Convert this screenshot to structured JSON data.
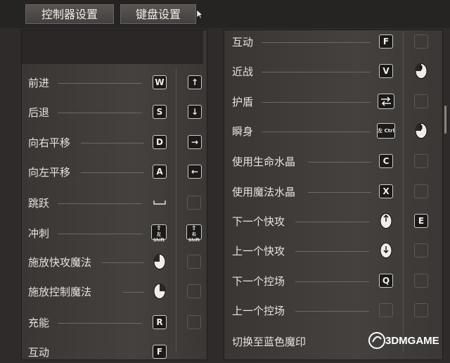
{
  "tabs": [
    {
      "label": "控制器设置"
    },
    {
      "label": "键盘设置"
    }
  ],
  "left_rows": [
    {
      "label": "前进",
      "primary": "W",
      "secondary": "↑"
    },
    {
      "label": "后退",
      "primary": "S",
      "secondary": "↓"
    },
    {
      "label": "向右平移",
      "primary": "D",
      "secondary": "→"
    },
    {
      "label": "向左平移",
      "primary": "A",
      "secondary": "←"
    },
    {
      "label": "跳跃",
      "primary": "space-key",
      "secondary": ""
    },
    {
      "label": "冲刺",
      "primary": "左 Shift",
      "secondary": "右 Shift"
    },
    {
      "label": "施放快攻魔法",
      "primary": "left-mouse-icon",
      "secondary": ""
    },
    {
      "label": "施放控制魔法",
      "primary": "right-mouse-icon",
      "secondary": ""
    },
    {
      "label": "充能",
      "primary": "R",
      "secondary": ""
    },
    {
      "label": "互动",
      "primary": "F",
      "secondary": ""
    }
  ],
  "right_rows": [
    {
      "label": "互动",
      "primary": "F",
      "secondary": ""
    },
    {
      "label": "近战",
      "primary": "V",
      "secondary": "middle-mouse-icon"
    },
    {
      "label": "护盾",
      "primary": "tab-key-icon",
      "secondary": ""
    },
    {
      "label": "瞬身",
      "primary": "左 Ctrl",
      "secondary": "middle-mouse-icon"
    },
    {
      "label": "使用生命水晶",
      "primary": "C",
      "secondary": ""
    },
    {
      "label": "使用魔法水晶",
      "primary": "X",
      "secondary": ""
    },
    {
      "label": "下一个快攻",
      "primary": "scroll-up-icon",
      "secondary": "E"
    },
    {
      "label": "上一个快攻",
      "primary": "scroll-down-icon",
      "secondary": ""
    },
    {
      "label": "下一个控场",
      "primary": "Q",
      "secondary": ""
    },
    {
      "label": "上一个控场",
      "primary": "",
      "secondary": ""
    },
    {
      "label": "切换至蓝色魔印",
      "primary": "",
      "secondary": ""
    }
  ],
  "keys": {
    "shift_left_top": "⇧",
    "shift_left_bottom": "左 Shift",
    "shift_right_top": "⇧",
    "shift_right_bottom": "右 Shift",
    "ctrl_left": "左 Ctrl"
  },
  "watermark": {
    "text": "3DMGAME"
  }
}
